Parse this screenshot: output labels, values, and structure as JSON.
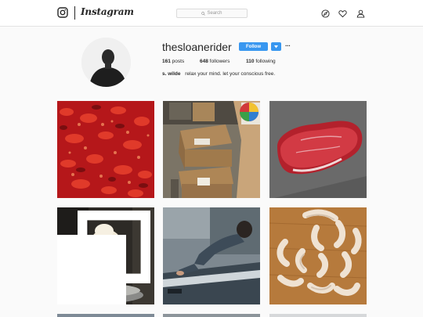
{
  "nav": {
    "brand": "Instagram",
    "search_placeholder": "Search",
    "icons": [
      "explore-icon",
      "heart-icon",
      "profile-icon"
    ]
  },
  "profile": {
    "username": "thesloanerider",
    "follow_label": "Follow",
    "more_label": "···",
    "posts_count": "161",
    "posts_label": "posts",
    "followers_count": "648",
    "followers_label": "followers",
    "following_count": "110",
    "following_label": "following",
    "bio_name": "s. wilde",
    "bio_text": "relax your mind. let your conscious free."
  },
  "posts": [
    {
      "subject": "red peppers"
    },
    {
      "subject": "cardboard boxes"
    },
    {
      "subject": "raw steak"
    },
    {
      "subject": "ice cream cone",
      "multi": true
    },
    {
      "subject": "man leaning on car"
    },
    {
      "subject": "sausages"
    }
  ],
  "colors": {
    "accent": "#3897f0",
    "border": "#e3e3e3",
    "background": "#fafafa"
  }
}
